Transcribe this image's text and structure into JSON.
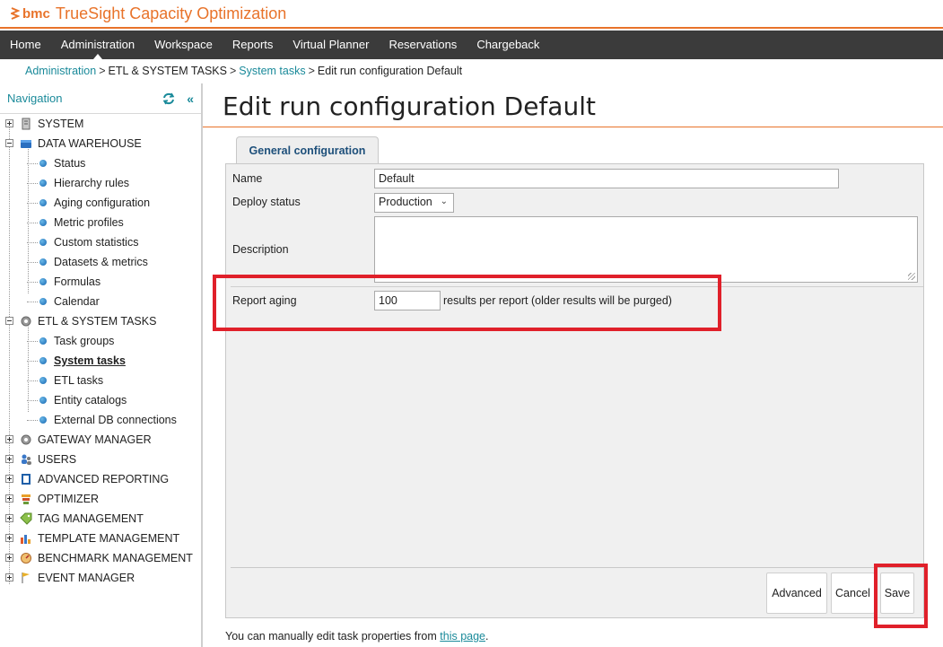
{
  "brand": {
    "company": "bmc",
    "product": "TrueSight Capacity Optimization"
  },
  "nav": {
    "items": [
      {
        "label": "Home",
        "active": false
      },
      {
        "label": "Administration",
        "active": true
      },
      {
        "label": "Workspace",
        "active": false
      },
      {
        "label": "Reports",
        "active": false
      },
      {
        "label": "Virtual Planner",
        "active": false
      },
      {
        "label": "Reservations",
        "active": false
      },
      {
        "label": "Chargeback",
        "active": false
      }
    ]
  },
  "breadcrumb": {
    "items": [
      "Administration",
      "ETL & SYSTEM TASKS",
      "System tasks",
      "Edit run configuration Default"
    ],
    "separator": ">"
  },
  "sidebar": {
    "title": "Navigation",
    "collapse_glyph": "«",
    "tree": [
      {
        "label": "SYSTEM",
        "icon": "server-icon",
        "expanded": false
      },
      {
        "label": "DATA WAREHOUSE",
        "icon": "database-icon",
        "expanded": true,
        "children": [
          "Status",
          "Hierarchy rules",
          "Aging configuration",
          "Metric profiles",
          "Custom statistics",
          "Datasets & metrics",
          "Formulas",
          "Calendar"
        ]
      },
      {
        "label": "ETL & SYSTEM TASKS",
        "icon": "gear-icon",
        "expanded": true,
        "children": [
          "Task groups",
          "System tasks",
          "ETL tasks",
          "Entity catalogs",
          "External DB connections"
        ],
        "selected": "System tasks"
      },
      {
        "label": "GATEWAY MANAGER",
        "icon": "gear-icon",
        "expanded": false
      },
      {
        "label": "USERS",
        "icon": "users-icon",
        "expanded": false
      },
      {
        "label": "ADVANCED REPORTING",
        "icon": "report-icon",
        "expanded": false
      },
      {
        "label": "OPTIMIZER",
        "icon": "optimizer-icon",
        "expanded": false
      },
      {
        "label": "TAG MANAGEMENT",
        "icon": "tag-icon",
        "expanded": false
      },
      {
        "label": "TEMPLATE MANAGEMENT",
        "icon": "template-icon",
        "expanded": false
      },
      {
        "label": "BENCHMARK MANAGEMENT",
        "icon": "benchmark-icon",
        "expanded": false
      },
      {
        "label": "EVENT MANAGER",
        "icon": "flag-icon",
        "expanded": false
      }
    ]
  },
  "page": {
    "title": "Edit run configuration Default"
  },
  "tabs": [
    {
      "label": "General configuration",
      "active": true
    }
  ],
  "form": {
    "name_label": "Name",
    "name_value": "Default",
    "deploy_label": "Deploy status",
    "deploy_value": "Production",
    "description_label": "Description",
    "description_value": "",
    "aging_label": "Report aging",
    "aging_value": "100",
    "aging_hint": "results per report (older results will be purged)"
  },
  "buttons": {
    "advanced": "Advanced",
    "cancel": "Cancel",
    "save": "Save"
  },
  "footer": {
    "note_prefix": "You can manually edit task properties from",
    "note_link": "this page",
    "note_suffix": "."
  },
  "colors": {
    "accent": "#e8732a",
    "nav_bg": "#3b3b3b",
    "link": "#1a8a9a",
    "highlight": "#e0202a"
  }
}
